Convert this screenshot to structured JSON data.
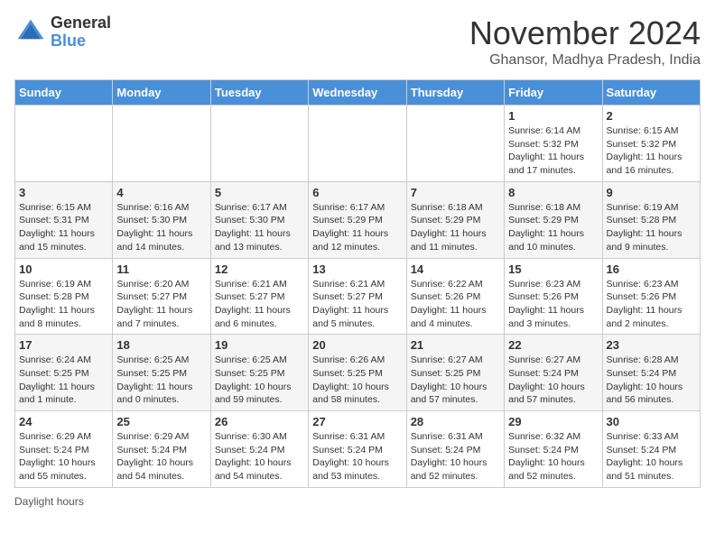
{
  "logo": {
    "general": "General",
    "blue": "Blue"
  },
  "title": "November 2024",
  "location": "Ghansor, Madhya Pradesh, India",
  "weekdays": [
    "Sunday",
    "Monday",
    "Tuesday",
    "Wednesday",
    "Thursday",
    "Friday",
    "Saturday"
  ],
  "footer": {
    "daylight_label": "Daylight hours"
  },
  "weeks": [
    [
      {
        "day": "",
        "info": ""
      },
      {
        "day": "",
        "info": ""
      },
      {
        "day": "",
        "info": ""
      },
      {
        "day": "",
        "info": ""
      },
      {
        "day": "",
        "info": ""
      },
      {
        "day": "1",
        "info": "Sunrise: 6:14 AM\nSunset: 5:32 PM\nDaylight: 11 hours and 17 minutes."
      },
      {
        "day": "2",
        "info": "Sunrise: 6:15 AM\nSunset: 5:32 PM\nDaylight: 11 hours and 16 minutes."
      }
    ],
    [
      {
        "day": "3",
        "info": "Sunrise: 6:15 AM\nSunset: 5:31 PM\nDaylight: 11 hours and 15 minutes."
      },
      {
        "day": "4",
        "info": "Sunrise: 6:16 AM\nSunset: 5:30 PM\nDaylight: 11 hours and 14 minutes."
      },
      {
        "day": "5",
        "info": "Sunrise: 6:17 AM\nSunset: 5:30 PM\nDaylight: 11 hours and 13 minutes."
      },
      {
        "day": "6",
        "info": "Sunrise: 6:17 AM\nSunset: 5:29 PM\nDaylight: 11 hours and 12 minutes."
      },
      {
        "day": "7",
        "info": "Sunrise: 6:18 AM\nSunset: 5:29 PM\nDaylight: 11 hours and 11 minutes."
      },
      {
        "day": "8",
        "info": "Sunrise: 6:18 AM\nSunset: 5:29 PM\nDaylight: 11 hours and 10 minutes."
      },
      {
        "day": "9",
        "info": "Sunrise: 6:19 AM\nSunset: 5:28 PM\nDaylight: 11 hours and 9 minutes."
      }
    ],
    [
      {
        "day": "10",
        "info": "Sunrise: 6:19 AM\nSunset: 5:28 PM\nDaylight: 11 hours and 8 minutes."
      },
      {
        "day": "11",
        "info": "Sunrise: 6:20 AM\nSunset: 5:27 PM\nDaylight: 11 hours and 7 minutes."
      },
      {
        "day": "12",
        "info": "Sunrise: 6:21 AM\nSunset: 5:27 PM\nDaylight: 11 hours and 6 minutes."
      },
      {
        "day": "13",
        "info": "Sunrise: 6:21 AM\nSunset: 5:27 PM\nDaylight: 11 hours and 5 minutes."
      },
      {
        "day": "14",
        "info": "Sunrise: 6:22 AM\nSunset: 5:26 PM\nDaylight: 11 hours and 4 minutes."
      },
      {
        "day": "15",
        "info": "Sunrise: 6:23 AM\nSunset: 5:26 PM\nDaylight: 11 hours and 3 minutes."
      },
      {
        "day": "16",
        "info": "Sunrise: 6:23 AM\nSunset: 5:26 PM\nDaylight: 11 hours and 2 minutes."
      }
    ],
    [
      {
        "day": "17",
        "info": "Sunrise: 6:24 AM\nSunset: 5:25 PM\nDaylight: 11 hours and 1 minute."
      },
      {
        "day": "18",
        "info": "Sunrise: 6:25 AM\nSunset: 5:25 PM\nDaylight: 11 hours and 0 minutes."
      },
      {
        "day": "19",
        "info": "Sunrise: 6:25 AM\nSunset: 5:25 PM\nDaylight: 10 hours and 59 minutes."
      },
      {
        "day": "20",
        "info": "Sunrise: 6:26 AM\nSunset: 5:25 PM\nDaylight: 10 hours and 58 minutes."
      },
      {
        "day": "21",
        "info": "Sunrise: 6:27 AM\nSunset: 5:25 PM\nDaylight: 10 hours and 57 minutes."
      },
      {
        "day": "22",
        "info": "Sunrise: 6:27 AM\nSunset: 5:24 PM\nDaylight: 10 hours and 57 minutes."
      },
      {
        "day": "23",
        "info": "Sunrise: 6:28 AM\nSunset: 5:24 PM\nDaylight: 10 hours and 56 minutes."
      }
    ],
    [
      {
        "day": "24",
        "info": "Sunrise: 6:29 AM\nSunset: 5:24 PM\nDaylight: 10 hours and 55 minutes."
      },
      {
        "day": "25",
        "info": "Sunrise: 6:29 AM\nSunset: 5:24 PM\nDaylight: 10 hours and 54 minutes."
      },
      {
        "day": "26",
        "info": "Sunrise: 6:30 AM\nSunset: 5:24 PM\nDaylight: 10 hours and 54 minutes."
      },
      {
        "day": "27",
        "info": "Sunrise: 6:31 AM\nSunset: 5:24 PM\nDaylight: 10 hours and 53 minutes."
      },
      {
        "day": "28",
        "info": "Sunrise: 6:31 AM\nSunset: 5:24 PM\nDaylight: 10 hours and 52 minutes."
      },
      {
        "day": "29",
        "info": "Sunrise: 6:32 AM\nSunset: 5:24 PM\nDaylight: 10 hours and 52 minutes."
      },
      {
        "day": "30",
        "info": "Sunrise: 6:33 AM\nSunset: 5:24 PM\nDaylight: 10 hours and 51 minutes."
      }
    ]
  ]
}
